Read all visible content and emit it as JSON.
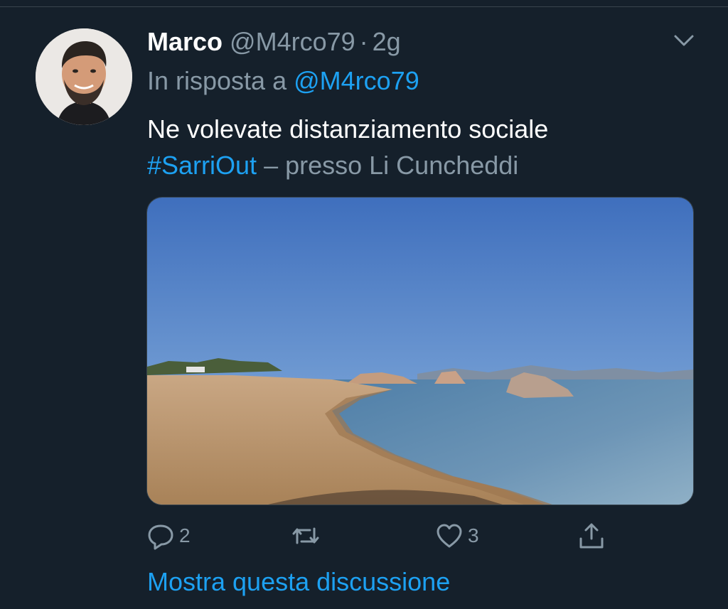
{
  "tweet": {
    "author_name": "Marco",
    "author_handle": "@M4rco79",
    "separator": "·",
    "timestamp": "2g",
    "reply_prefix": "In risposta a",
    "reply_to": "@M4rco79",
    "text": "Ne volevate distanziamento sociale",
    "hashtag": "#SarriOut",
    "place_text": "– presso Li Cuncheddi",
    "reply_count": "2",
    "like_count": "3",
    "show_thread_label": "Mostra questa discussione"
  },
  "icons": {
    "more": "chevron-down-icon",
    "reply": "reply-icon",
    "retweet": "retweet-icon",
    "like": "heart-icon",
    "share": "share-icon"
  },
  "colors": {
    "background": "#15202b",
    "accent": "#1da1f2",
    "secondary_text": "#8899a6",
    "divider": "#38444d"
  }
}
